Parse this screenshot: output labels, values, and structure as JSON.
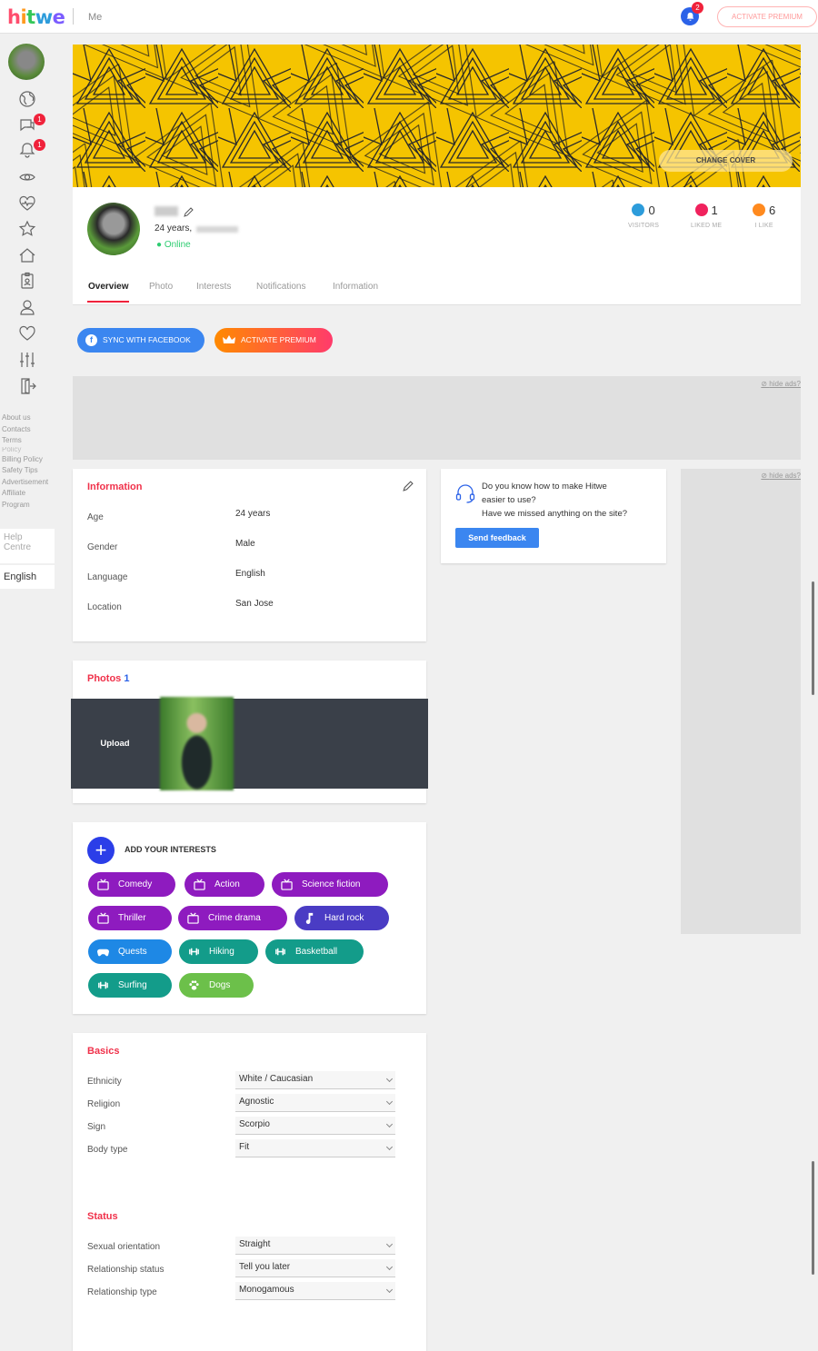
{
  "header": {
    "logo": [
      "h",
      "i",
      "t",
      "w",
      "e"
    ],
    "page_title": "Me",
    "notifications_count": "2",
    "premium_label": "ACTIVATE PREMIUM"
  },
  "sidebar": {
    "messages_badge": "1",
    "notifications_badge": "1",
    "links": [
      "About us",
      "Contacts",
      "Terms",
      "Policy",
      "Billing Policy",
      "Safety Tips",
      "Advertisement",
      "Affiliate",
      "Program"
    ],
    "help": "Help Centre",
    "language": "English"
  },
  "cover": {
    "change_label": "CHANGE COVER"
  },
  "profile": {
    "age_text": "24 years,",
    "status": "Online",
    "stats": [
      {
        "value": "0",
        "label": "VISITORS",
        "color": "#2d9cdb"
      },
      {
        "value": "1",
        "label": "LIKED ME",
        "color": "#f0225d"
      },
      {
        "value": "6",
        "label": "I LIKE",
        "color": "#ff8a1f"
      }
    ],
    "tabs": [
      "Overview",
      "Photo",
      "Interests",
      "Notifications",
      "Information"
    ]
  },
  "actions": {
    "sync": "SYNC WITH FACEBOOK",
    "premium": "ACTIVATE PREMIUM"
  },
  "ads": {
    "hide": "hide ads?"
  },
  "information": {
    "title": "Information",
    "rows": [
      {
        "label": "Age",
        "value": "24 years"
      },
      {
        "label": "Gender",
        "value": "Male"
      },
      {
        "label": "Language",
        "value": "English"
      },
      {
        "label": "Location",
        "value": "San Jose"
      }
    ]
  },
  "feedback": {
    "line1": "Do you know how to make Hitwe",
    "line2": "easier to use?",
    "line3": "Have we missed anything on the site?",
    "button": "Send feedback"
  },
  "photos": {
    "title": "Photos",
    "count": "1",
    "upload": "Upload"
  },
  "interests": {
    "add_label": "ADD YOUR INTERESTS",
    "chips": [
      {
        "label": "Comedy",
        "icon": "tv-icon",
        "color": "#8e1bbf"
      },
      {
        "label": "Action",
        "icon": "tv-icon",
        "color": "#8e1bbf"
      },
      {
        "label": "Science fiction",
        "icon": "tv-icon",
        "color": "#8e1bbf"
      },
      {
        "label": "Thriller",
        "icon": "tv-icon",
        "color": "#8e1bbf"
      },
      {
        "label": "Crime drama",
        "icon": "tv-icon",
        "color": "#8e1bbf"
      },
      {
        "label": "Hard rock",
        "icon": "music-note-icon",
        "color": "#4a3cc4"
      },
      {
        "label": "Quests",
        "icon": "gamepad-icon",
        "color": "#1e88e5"
      },
      {
        "label": "Hiking",
        "icon": "dumbbell-icon",
        "color": "#139c8a"
      },
      {
        "label": "Basketball",
        "icon": "dumbbell-icon",
        "color": "#139c8a"
      },
      {
        "label": "Surfing",
        "icon": "dumbbell-icon",
        "color": "#139c8a"
      },
      {
        "label": "Dogs",
        "icon": "paw-icon",
        "color": "#6cc04a"
      }
    ]
  },
  "basics": {
    "title": "Basics",
    "rows": [
      {
        "label": "Ethnicity",
        "value": "White / Caucasian"
      },
      {
        "label": "Religion",
        "value": "Agnostic"
      },
      {
        "label": "Sign",
        "value": "Scorpio"
      },
      {
        "label": "Body type",
        "value": "Fit"
      }
    ]
  },
  "status": {
    "title": "Status",
    "rows": [
      {
        "label": "Sexual orientation",
        "value": "Straight"
      },
      {
        "label": "Relationship status",
        "value": "Tell you later"
      },
      {
        "label": "Relationship type",
        "value": "Monogamous"
      }
    ]
  }
}
